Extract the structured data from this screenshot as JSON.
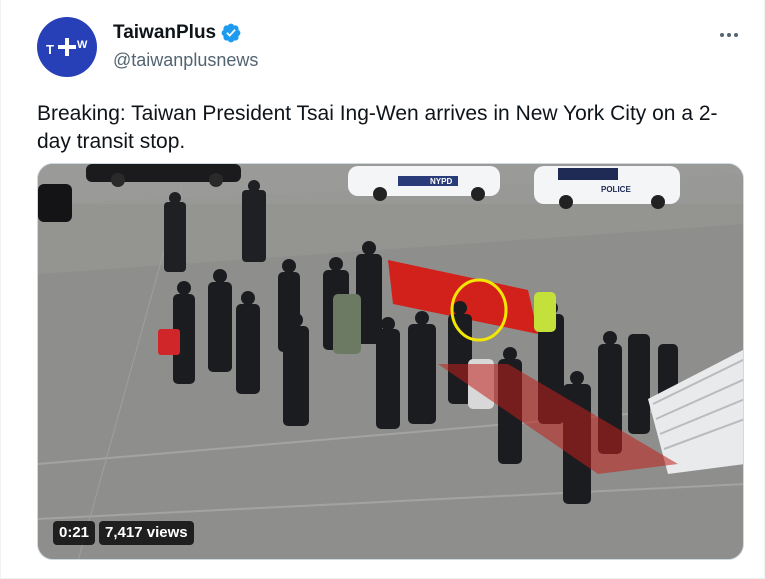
{
  "author": {
    "display_name": "TaiwanPlus",
    "handle": "@taiwanplusnews",
    "avatar_text": "T+W",
    "verified": true
  },
  "tweet": {
    "text": "Breaking: Taiwan President Tsai Ing-Wen arrives in New York City on a 2-day transit stop."
  },
  "media": {
    "type": "video",
    "duration": "0:21",
    "views": "7,417 views",
    "scene_labels": {
      "police_car_1": "NYPD",
      "police_car_2": "POLICE"
    }
  },
  "colors": {
    "avatar_bg": "#2740b8",
    "verified": "#1d9bf0",
    "highlight_circle": "#f3e600",
    "banner": "#d2211b"
  },
  "icons": {
    "more": "more-icon",
    "verified": "verified-badge-icon"
  }
}
